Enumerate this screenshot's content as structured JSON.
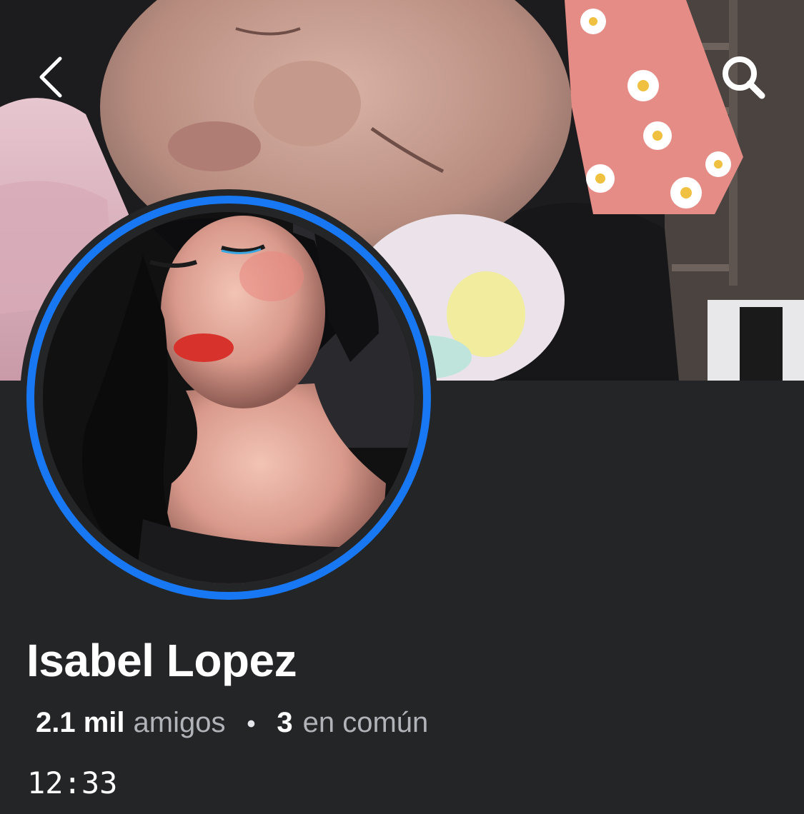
{
  "header": {
    "back_icon": "chevron-left-icon",
    "search_icon": "search-icon"
  },
  "profile": {
    "name": "Isabel Lopez",
    "friends_count": "2.1 mil",
    "friends_label": "amigos",
    "separator": "•",
    "mutual_count": "3",
    "mutual_label": "en común",
    "time": "12:33"
  },
  "colors": {
    "background": "#242526",
    "avatar_ring": "#1877f2",
    "name_text": "#ffffff",
    "muted_text": "#b0b3b8"
  }
}
